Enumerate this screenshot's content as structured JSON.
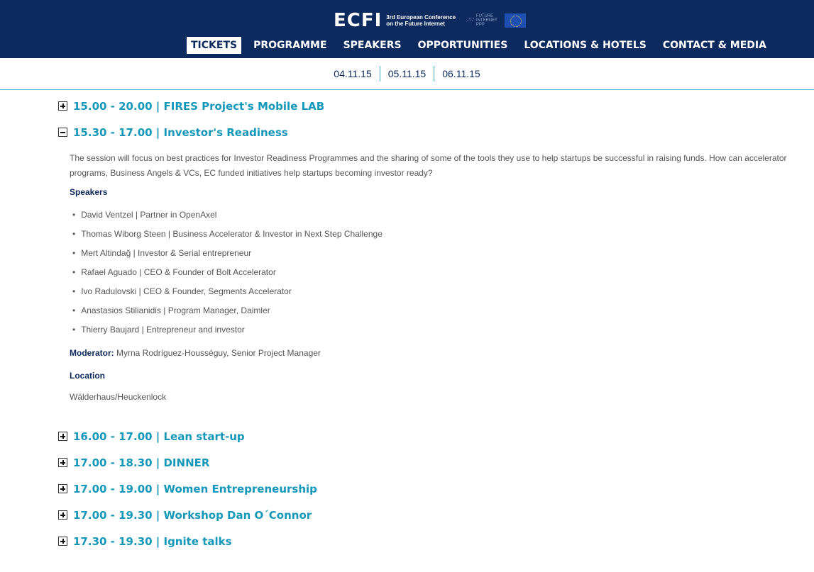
{
  "header": {
    "logo": "ECFI",
    "conference_line1": "3rd European Conference",
    "conference_line2": "on the Future Internet",
    "partner_logo": "FUTURE INTERNET PPP",
    "nav": [
      {
        "label": "TICKETS"
      },
      {
        "label": "PROGRAMME"
      },
      {
        "label": "SPEAKERS"
      },
      {
        "label": "OPPORTUNITIES"
      },
      {
        "label": "LOCATIONS & HOTELS"
      },
      {
        "label": "CONTACT & MEDIA"
      }
    ],
    "active_nav": "TICKETS"
  },
  "dates": [
    "04.11.15",
    "05.11.15",
    "06.11.15"
  ],
  "sessions": [
    {
      "title": "15.00 - 20.00 | FIRES Project's Mobile LAB",
      "expanded": false
    },
    {
      "title": "15.30 - 17.00 | Investor's Readiness",
      "expanded": true
    },
    {
      "title": "16.00 - 17.00 | Lean start-up",
      "expanded": false
    },
    {
      "title": "17.00 - 18.30 | DINNER",
      "expanded": false
    },
    {
      "title": "17.00 - 19.00 | Women Entrepreneurship",
      "expanded": false
    },
    {
      "title": "17.00 - 19.30 | Workshop Dan O´Connor",
      "expanded": false
    },
    {
      "title": "17.30 - 19.30 | Ignite talks",
      "expanded": false
    }
  ],
  "expanded_detail": {
    "description": "The session will focus on best practices for Investor Readiness Programmes and the sharing of some of the tools they use to help startups be successful in raising funds.  How can accelerator programs, Business Angels & VCs, EC funded initiatives help startups becoming investor ready?",
    "speakers_heading": "Speakers",
    "speakers": [
      "David Ventzel | Partner in OpenAxel",
      "Thomas Wiborg Steen | Business Accelerator & Investor in Next Step Challenge",
      "Mert Altindağ | Investor & Serial entrepreneur",
      "Rafael Aguado | CEO & Founder of Bolt Accelerator",
      "Ivo Radulovski | CEO & Founder, Segments Accelerator",
      "Anastasios Stilianidis | Program Manager, Daimler",
      "Thierry Baujard | Entrepreneur and investor"
    ],
    "moderator_label": "Moderator:",
    "moderator_value": " Myrna Rodríguez-Housséguy, Senior Project Manager",
    "location_heading": "Location",
    "location_value": "Wälderhaus/Heuckenlock"
  },
  "icons": {
    "collapsed": "plus-box-icon",
    "expanded": "minus-box-icon"
  },
  "colors": {
    "header_bg": "#0c2a5e",
    "session_title": "#1597b9",
    "divider": "#3fb3c4"
  }
}
